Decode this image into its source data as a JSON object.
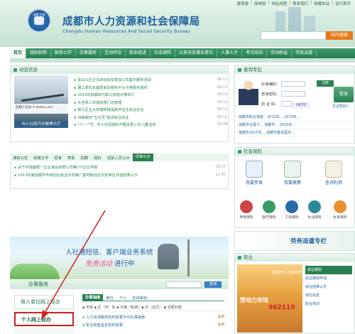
{
  "top_links": [
    "繁体版",
    "|",
    "简体版",
    "|",
    "网站地图",
    "|",
    "联系我们",
    "|",
    "收藏本站",
    "|",
    "设为首页"
  ],
  "header": {
    "logo_text": "成都 社保",
    "title": "成都市人力资源和社会保障局",
    "subtitle": "Chengdu Human Resources And Social Security Bureau",
    "search_button": "站内搜索"
  },
  "nav": {
    "items": [
      "首页",
      "组织机构",
      "政务公开",
      "办事服务",
      "互动评议",
      "就业促进",
      "社会保险",
      "公务员及事业单位",
      "人事人才",
      "考试培训",
      "劳动权益",
      "劳务派遣"
    ]
  },
  "news": {
    "heading": "动态信息",
    "photo_caption": "市人社局开办微博大厅",
    "weibo_text": "成都人社局 V weibo.com",
    "items": [
      {
        "title": "青白江区正式启动扶贫帮扶公司集中服务活动",
        "date": "06-11"
      },
      {
        "title": "蒲江县优化基层就业服务平台下移服务事项",
        "date": "06-11"
      },
      {
        "title": "2015年成都四万职工技能大赛举行",
        "date": "06-11"
      },
      {
        "title": "大邑县三举措加强门诊管理",
        "date": "06-11"
      },
      {
        "title": "锦江区五大举措积极提高毕业生就业创业",
        "date": "06-11"
      },
      {
        "title": "邛崃做好\"五大员\"促进就业创业",
        "date": "06-11"
      },
      {
        "title": "\"六·一\"节，市人社局组织开展关爱少年儿童活动",
        "date": "06-09"
      }
    ]
  },
  "notice": {
    "tabs": [
      "通知公告",
      "政策文件",
      "招考",
      "表彰",
      "招聘",
      "招标",
      "招投人员公示",
      "评审公示"
    ],
    "active_tab": "评审公示",
    "items": [
      {
        "title": "关于对成都统一企业食品有限公司等7户企业申报..",
        "date": "05-27"
      },
      {
        "title": "2013年度成都市市级创业就业示范推广基地和创业示范单位评选结果公示",
        "date": "12-30"
      }
    ]
  },
  "banner": {
    "line1": "人社通短信、客户端业务系统",
    "line2_pre": "",
    "line2_em": "免费活动",
    "line2_post": " 进行中"
  },
  "service": {
    "heading": "办事服务",
    "search_button": "查询",
    "left_menu": [
      "用人单位网上经办",
      "个人网上经办"
    ],
    "tabs": [
      "办事指南",
      "单位",
      "个人",
      "在线审批"
    ],
    "active_tab": "办事指南",
    "filter": "▪ 市级 ▪ 区（市）县 ▪ 乡镇（街道）▪ 村（社区） ▪ 全部办理",
    "items": [
      {
        "title": "人力资源服务机构变更许可办事指南",
        "date": "查阅"
      },
      {
        "title": "职业技能鉴定机构变更",
        "date": "查阅"
      }
    ]
  },
  "query": {
    "heading": "查询专区",
    "fields": [
      "社保编码：",
      "查询密码：",
      "验 证 码："
    ],
    "register_button": "注册",
    "login_button": "登录",
    "captcha": "0670",
    "forgot": "忘记密码？",
    "items": [
      "成都市职业技能：2015年...   2015年...",
      "成都市社保卡...   成都市...   2015年...",
      "成都市2015年...   成都市基本医疗..."
    ]
  },
  "social": {
    "heading": "社会保险",
    "big": [
      "我要参保",
      "我要缴费",
      "查询利用"
    ],
    "small": [
      "养老保险",
      "医疗保险",
      "工伤保险",
      "失业保险",
      "生育保险"
    ]
  },
  "labor": {
    "title": "劳务派遣专栏"
  },
  "jobs": {
    "heading": "就业",
    "image_title": "劳动力市场",
    "image_sub": "成都市人力资源市场",
    "phone": "962110",
    "links": [
      "就业援助",
      "就业援助申请",
      "就业困难认定",
      "岗位信息",
      "职业培训"
    ]
  }
}
